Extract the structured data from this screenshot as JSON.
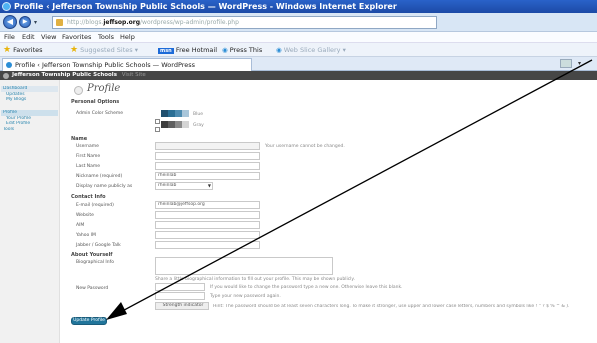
{
  "window": {
    "title": "Profile ‹ Jefferson Township Public Schools — WordPress - Windows Internet Explorer"
  },
  "address_bar": {
    "url_prefix": "http://blogs.",
    "url_domain": "jeffsop.org",
    "url_path": "/wordpress/wp-admin/profile.php"
  },
  "menu": [
    "File",
    "Edit",
    "View",
    "Favorites",
    "Tools",
    "Help"
  ],
  "favorites_bar": {
    "favorites": "Favorites",
    "suggested": "Suggested Sites ▾",
    "hotmail": "Free Hotmail",
    "press_this": "Press This",
    "web_slice": "Web Slice Gallery ▾"
  },
  "tab": {
    "title": "Profile ‹ Jefferson Township Public Schools — WordPress"
  },
  "wp": {
    "site_name": "Jefferson Township Public Schools",
    "visit": "Visit Site",
    "sidebar": [
      "Dashboard",
      "Updates",
      "My Blogs",
      "",
      "Profile",
      "Your Profile",
      "Edit Profile",
      "Tools"
    ],
    "page_title": "Profile",
    "personal_options": "Personal Options",
    "admin_color": "Admin Color Scheme",
    "color_blue": "Blue",
    "color_gray": "Gray",
    "name_section": "Name",
    "username_label": "Username",
    "username_note": "Your username cannot be changed.",
    "first_name_label": "First Name",
    "last_name_label": "Last Name",
    "nickname_label": "Nickname (required)",
    "nickname_value": "rheinlab",
    "display_label": "Display name publicly as",
    "display_value": "rheinlab",
    "contact_section": "Contact Info",
    "email_label": "E-mail (required)",
    "email_value": "rheinlab@jeffsop.org",
    "website_label": "Website",
    "aim_label": "AIM",
    "yahoo_label": "Yahoo IM",
    "jabber_label": "Jabber / Google Talk",
    "about_section": "About Yourself",
    "bio_label": "Biographical Info",
    "bio_note": "Share a little biographical information to fill out your profile. This may be shown publicly.",
    "password_label": "New Password",
    "password_note1": "If you would like to change the password type a new one. Otherwise leave this blank.",
    "password_note2": "Type your new password again.",
    "strength": "Strength indicator",
    "strength_hint": "Hint: The password should be at least seven characters long. To make it stronger, use upper and lower case letters, numbers and symbols like ! \" ? $ % ^ & ).",
    "update_button": "Update Profile"
  },
  "colors": {
    "titlebar": "#1c4aa6",
    "wp_admin_bar": "#464646",
    "link": "#2583ad",
    "primary_button": "#21759b"
  }
}
